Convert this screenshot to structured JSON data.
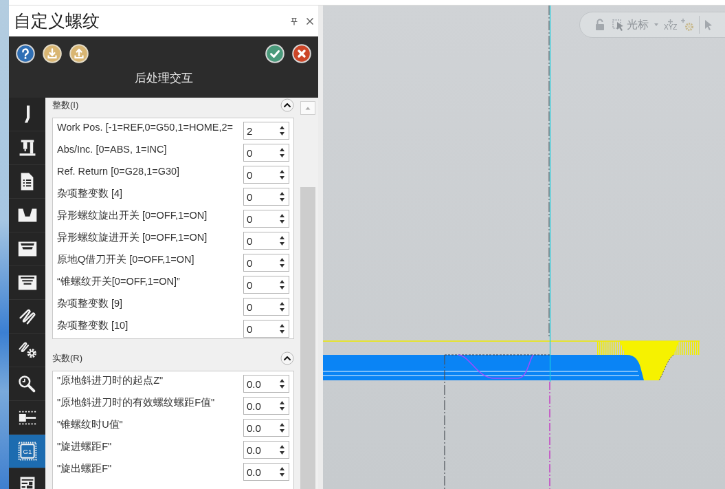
{
  "window": {
    "title": "自定义螺纹"
  },
  "header": {
    "title": "后处理交互"
  },
  "sidebar": {
    "items": [
      {
        "selected": false
      },
      {
        "selected": false
      },
      {
        "selected": false
      },
      {
        "selected": false
      },
      {
        "selected": false
      },
      {
        "selected": false
      },
      {
        "selected": false
      },
      {
        "selected": false
      },
      {
        "selected": false
      },
      {
        "selected": false
      },
      {
        "selected": true,
        "label": "G1"
      },
      {
        "selected": false
      }
    ]
  },
  "sections": [
    {
      "title": "整数(I)",
      "expanded": true,
      "rows": [
        {
          "label": "Work Pos. [-1=REF,0=G50,1=HOME,2=",
          "value": "2"
        },
        {
          "label": "Abs/Inc. [0=ABS, 1=INC]",
          "value": "0"
        },
        {
          "label": "Ref. Return [0=G28,1=G30]",
          "value": "0"
        },
        {
          "label": "杂项整变数 [4]",
          "value": "0"
        },
        {
          "label": "异形螺纹旋出开关 [0=OFF,1=ON]",
          "value": "0"
        },
        {
          "label": "异形螺纹旋进开关 [0=OFF,1=ON]",
          "value": "0"
        },
        {
          "label": "原地Q借刀开关 [0=OFF,1=ON]",
          "value": "0"
        },
        {
          "label": "“锥螺纹开关[0=OFF,1=ON]”",
          "value": "0"
        },
        {
          "label": "杂项整变数 [9]",
          "value": "0"
        },
        {
          "label": "杂项整变数 [10]",
          "value": "0"
        }
      ]
    },
    {
      "title": "实数(R)",
      "expanded": true,
      "rows": [
        {
          "label": "\"原地斜进刀时的起点Z\"",
          "value": "0.0"
        },
        {
          "label": "\"原地斜进刀时的有效螺纹螺距F值\"",
          "value": "0.0"
        },
        {
          "label": "\"锥螺纹时U值\"",
          "value": "0.0"
        },
        {
          "label": "\"旋进螺距F\"",
          "value": "0.0"
        },
        {
          "label": "\"旋出螺距F\"",
          "value": "0.0"
        }
      ]
    }
  ],
  "viewport": {
    "toolbar": {
      "cursor_label": "光标",
      "coordinate_label": "XYZ"
    }
  }
}
